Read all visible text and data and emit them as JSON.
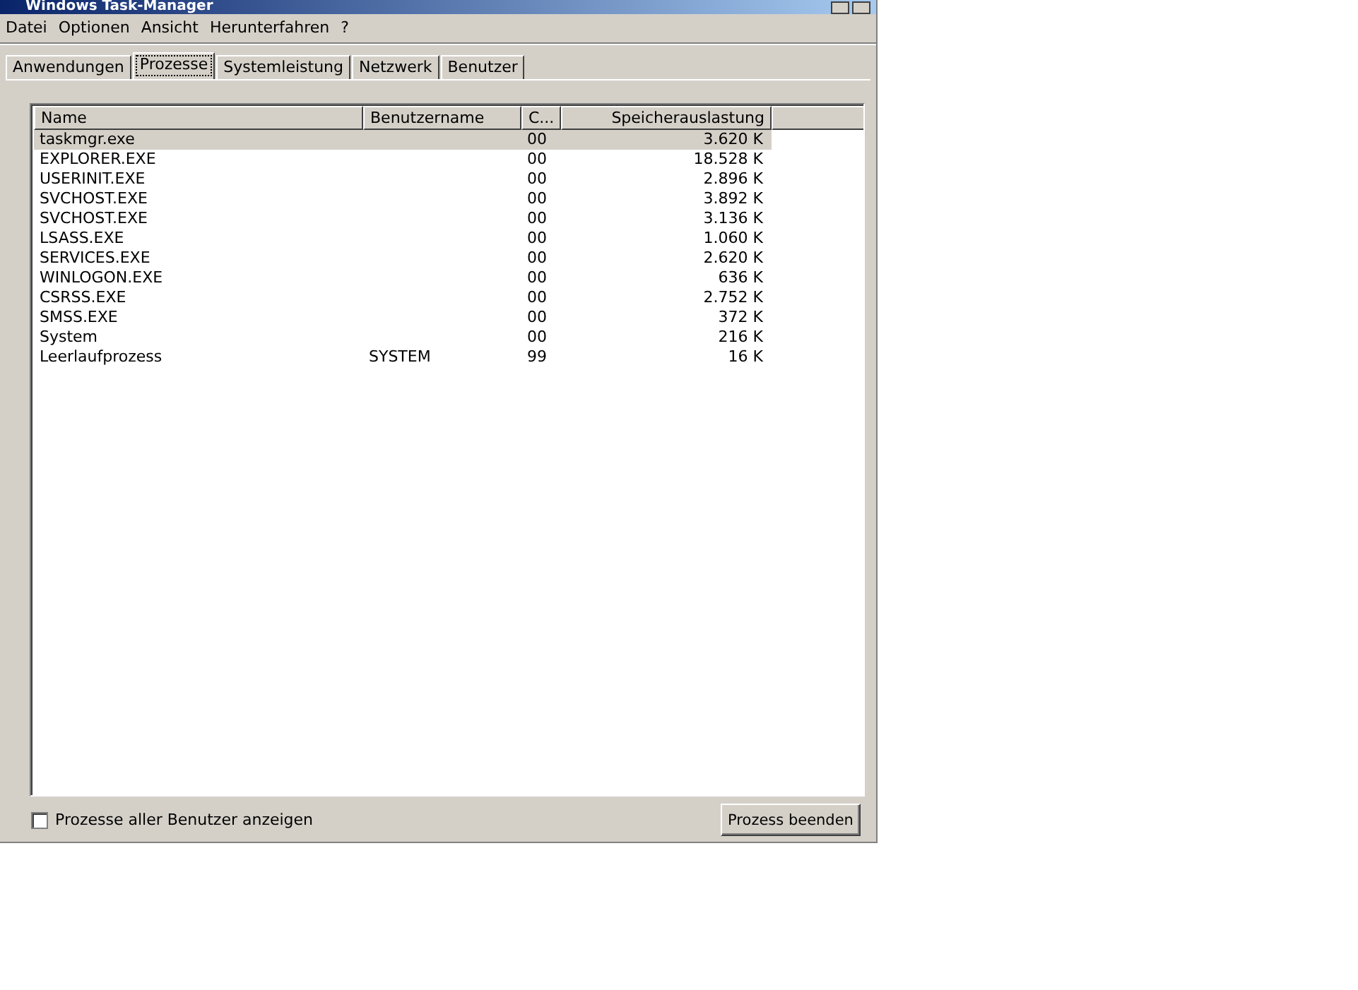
{
  "window": {
    "title": "Windows Task-Manager"
  },
  "menu": [
    "Datei",
    "Optionen",
    "Ansicht",
    "Herunterfahren",
    "?"
  ],
  "tabs": [
    {
      "label": "Anwendungen",
      "selected": false
    },
    {
      "label": "Prozesse",
      "selected": true
    },
    {
      "label": "Systemleistung",
      "selected": false
    },
    {
      "label": "Netzwerk",
      "selected": false
    },
    {
      "label": "Benutzer",
      "selected": false
    }
  ],
  "table": {
    "columns": [
      "Name",
      "Benutzername",
      "C...",
      "Speicherauslastung"
    ],
    "rows": [
      {
        "cells": [
          "taskmgr.exe",
          "",
          "00",
          "3.620 K"
        ],
        "selected": true
      },
      {
        "cells": [
          "EXPLORER.EXE",
          "",
          "00",
          "18.528 K"
        ],
        "selected": false
      },
      {
        "cells": [
          "USERINIT.EXE",
          "",
          "00",
          "2.896 K"
        ],
        "selected": false
      },
      {
        "cells": [
          "SVCHOST.EXE",
          "",
          "00",
          "3.892 K"
        ],
        "selected": false
      },
      {
        "cells": [
          "SVCHOST.EXE",
          "",
          "00",
          "3.136 K"
        ],
        "selected": false
      },
      {
        "cells": [
          "LSASS.EXE",
          "",
          "00",
          "1.060 K"
        ],
        "selected": false
      },
      {
        "cells": [
          "SERVICES.EXE",
          "",
          "00",
          "2.620 K"
        ],
        "selected": false
      },
      {
        "cells": [
          "WINLOGON.EXE",
          "",
          "00",
          "636 K"
        ],
        "selected": false
      },
      {
        "cells": [
          "CSRSS.EXE",
          "",
          "00",
          "2.752 K"
        ],
        "selected": false
      },
      {
        "cells": [
          "SMSS.EXE",
          "",
          "00",
          "372 K"
        ],
        "selected": false
      },
      {
        "cells": [
          "System",
          "",
          "00",
          "216 K"
        ],
        "selected": false
      },
      {
        "cells": [
          "Leerlaufprozess",
          "SYSTEM",
          "99",
          "16 K"
        ],
        "selected": false
      }
    ]
  },
  "show_all_users": {
    "label": "Prozesse aller Benutzer anzeigen",
    "checked": false
  },
  "end_button": "Prozess beenden"
}
